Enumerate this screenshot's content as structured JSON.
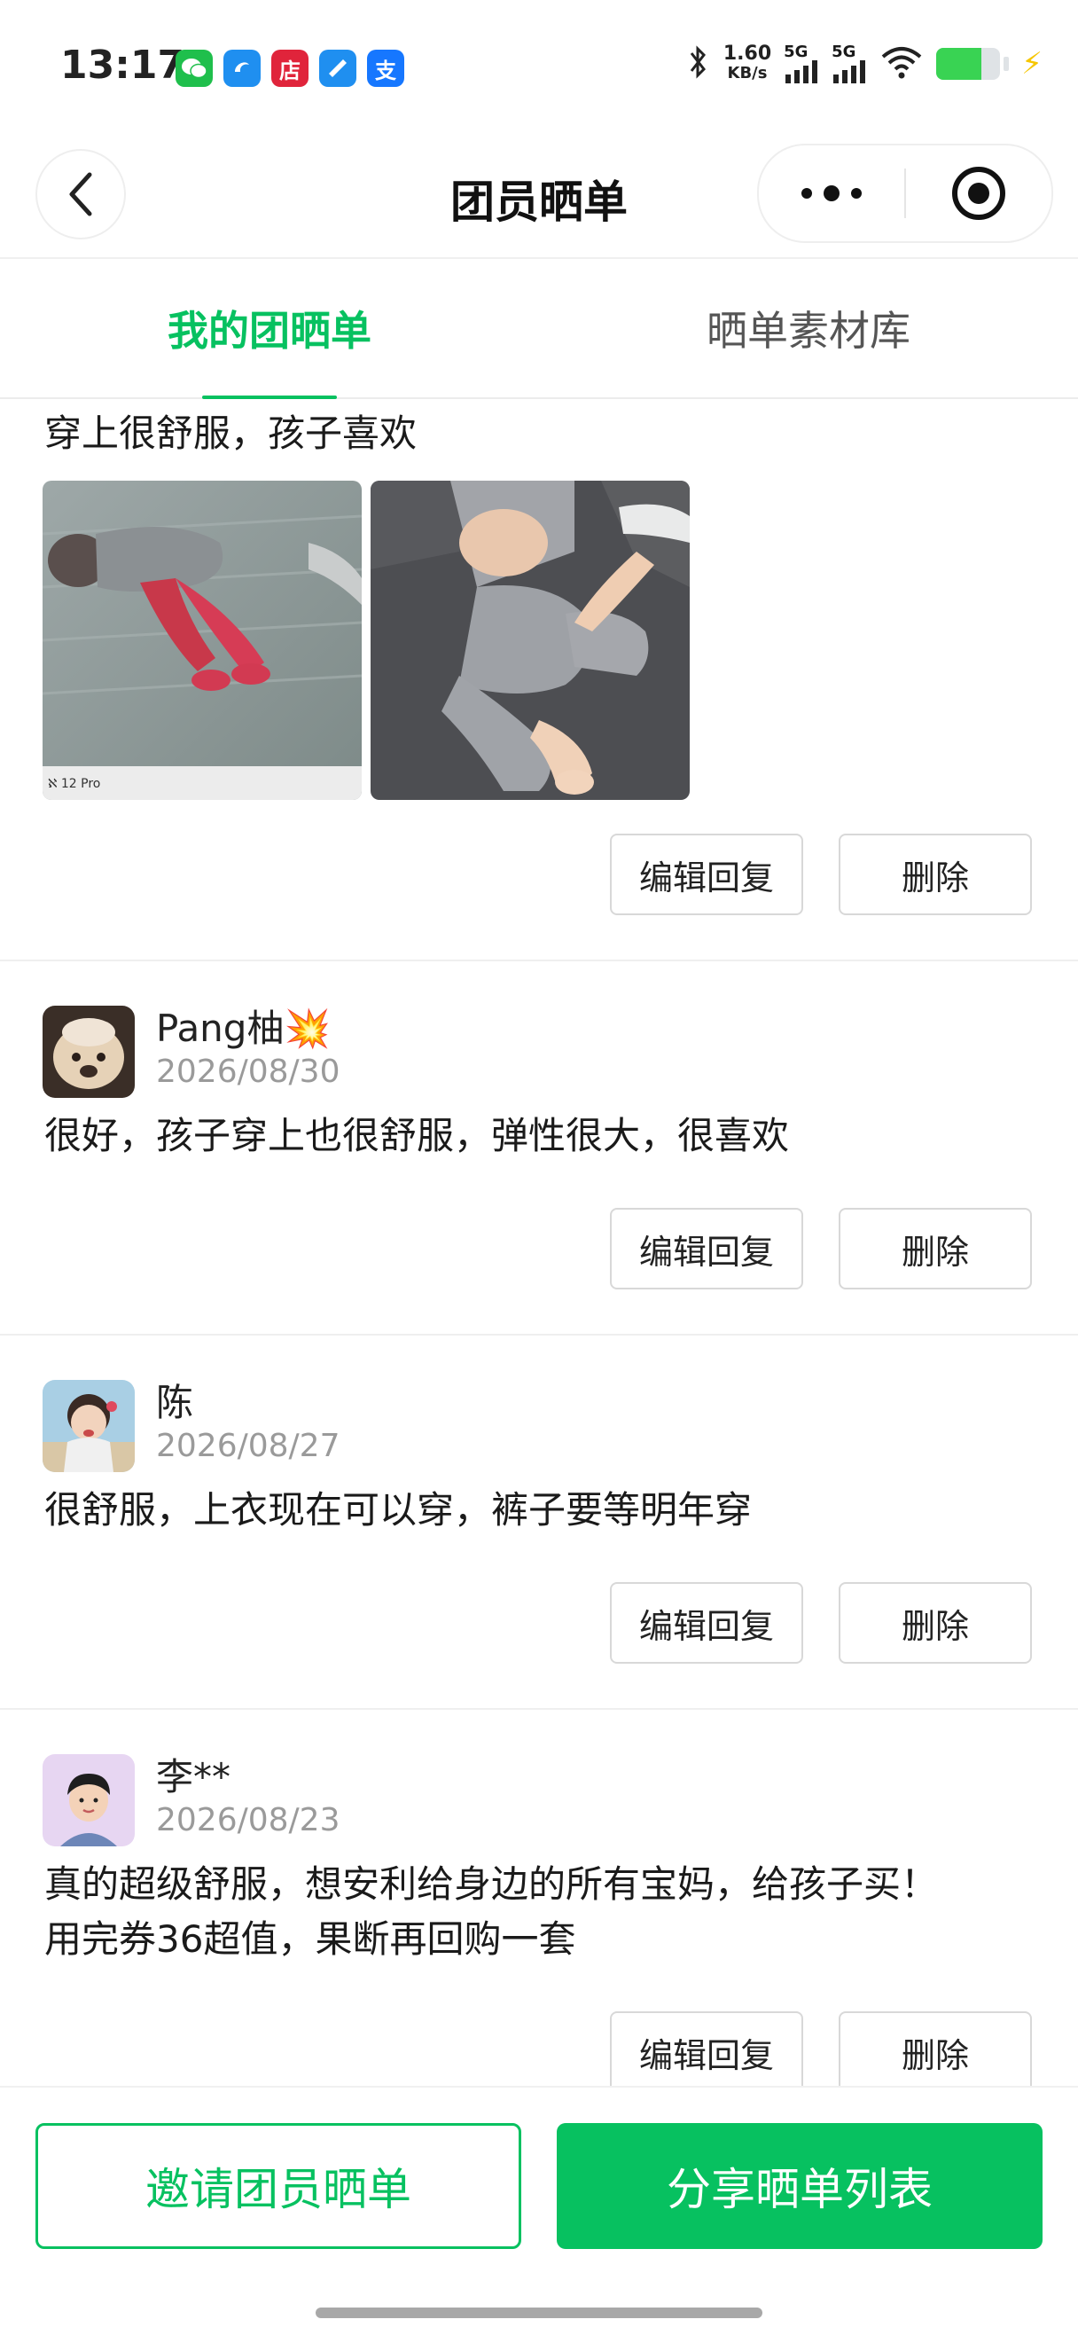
{
  "status_bar": {
    "time": "13:17",
    "speed_value": "1.60",
    "speed_unit": "KB/s",
    "signal1": "5G",
    "signal2": "5G",
    "apps": [
      "wechat-icon",
      "blue-app-icon",
      "store-icon",
      "blue-pen-icon",
      "alipay-icon"
    ],
    "app_labels": [
      "",
      "",
      "店",
      "",
      "支"
    ]
  },
  "nav": {
    "title": "团员晒单"
  },
  "tabs": [
    {
      "label": "我的团晒单",
      "active": true
    },
    {
      "label": "晒单素材库",
      "active": false
    }
  ],
  "reviews": [
    {
      "text": "穿上很舒服，孩子喜欢",
      "photo_caption": "ℵ 12 Pro",
      "edit_label": "编辑回复",
      "delete_label": "删除"
    },
    {
      "user": "Pang柚💥",
      "date": "2026/08/30",
      "text": "很好，孩子穿上也很舒服，弹性很大，很喜欢",
      "edit_label": "编辑回复",
      "delete_label": "删除"
    },
    {
      "user": "陈",
      "date": "2026/08/27",
      "text": "很舒服，上衣现在可以穿，裤子要等明年穿",
      "edit_label": "编辑回复",
      "delete_label": "删除"
    },
    {
      "user": "李**",
      "date": "2026/08/23",
      "text_line1": "真的超级舒服，想安利给身边的所有宝妈，给孩子买！",
      "text_line2": "用完券36超值，果断再回购一套",
      "edit_label": "编辑回复",
      "delete_label": "删除"
    }
  ],
  "bottom": {
    "invite_label": "邀请团员晒单",
    "share_label": "分享晒单列表"
  },
  "colors": {
    "accent": "#07c160"
  }
}
